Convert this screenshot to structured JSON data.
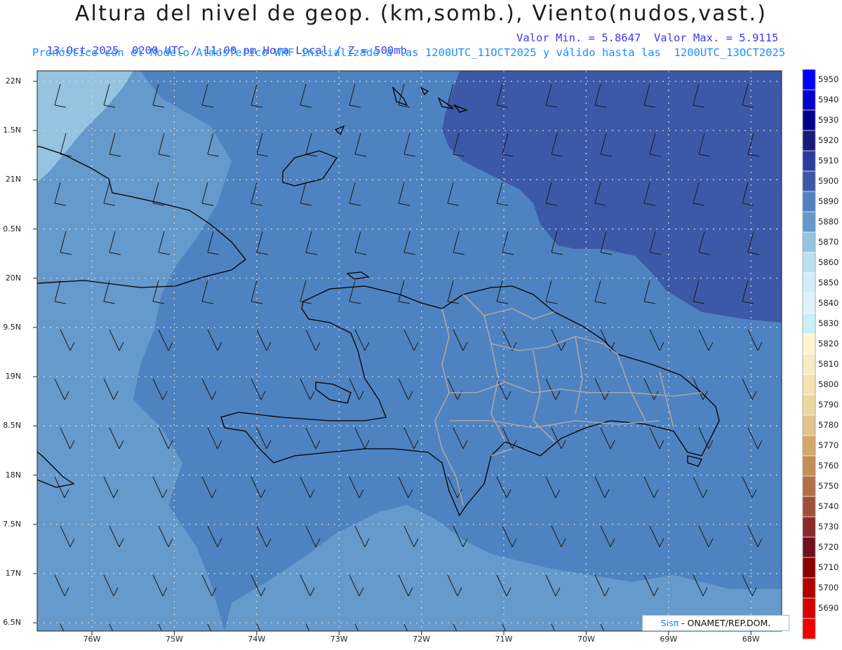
{
  "header": {
    "title": "Altura del nivel de geop. (km,somb.), Viento(nudos,vast.)",
    "line1_left": "13-Oct-2025  0200 UTC / 11:00 pm Hora Local / Z = 500mb",
    "line1_right": "Valor Min. = 5.8647  Valor Max. = 5.9115",
    "line2": "Pronóstico con el Modelo Atmosferico WRF inicializado a las 1200UTC_11OCT2025 y válido hasta las  1200UTC_13OCT2025"
  },
  "map": {
    "lat_labels": [
      "22N",
      "1.5N",
      "21N",
      "0.5N",
      "20N",
      "9.5N",
      "19N",
      "8.5N",
      "18N",
      "7.5N",
      "17N",
      "6.5N"
    ],
    "lon_labels": [
      "76W",
      "75W",
      "74W",
      "73W",
      "72W",
      "71W",
      "70W",
      "69W",
      "68W"
    ],
    "fill_colors": {
      "level_5870": "#94c4e0",
      "level_5880": "#6699cc",
      "level_5890": "#4f82c0",
      "level_5900": "#3c59a8"
    }
  },
  "colorbar": {
    "levels": [
      5950,
      5940,
      5930,
      5920,
      5910,
      5900,
      5890,
      5880,
      5870,
      5860,
      5850,
      5840,
      5830,
      5820,
      5810,
      5800,
      5790,
      5780,
      5770,
      5760,
      5750,
      5740,
      5730,
      5720,
      5710,
      5700,
      5690
    ],
    "colors": [
      "#0000ff",
      "#0000cd",
      "#00008b",
      "#1a1a7a",
      "#2b3d99",
      "#3c59a8",
      "#4f82c0",
      "#6699cc",
      "#94c4e0",
      "#b8e0f0",
      "#cfeef8",
      "#ddf2fa",
      "#c8f0f8",
      "#fff6d0",
      "#f8ecc2",
      "#f3e3b2",
      "#ecd7a0",
      "#e1c28a",
      "#d4a86c",
      "#c48e55",
      "#b27045",
      "#a05038",
      "#8b2a2a",
      "#6f1020",
      "#8b0000",
      "#b00000",
      "#d40000",
      "#f00000"
    ]
  },
  "credit": {
    "brand": "Sisπ",
    "text": "- ONAMET/REP.DOM."
  }
}
